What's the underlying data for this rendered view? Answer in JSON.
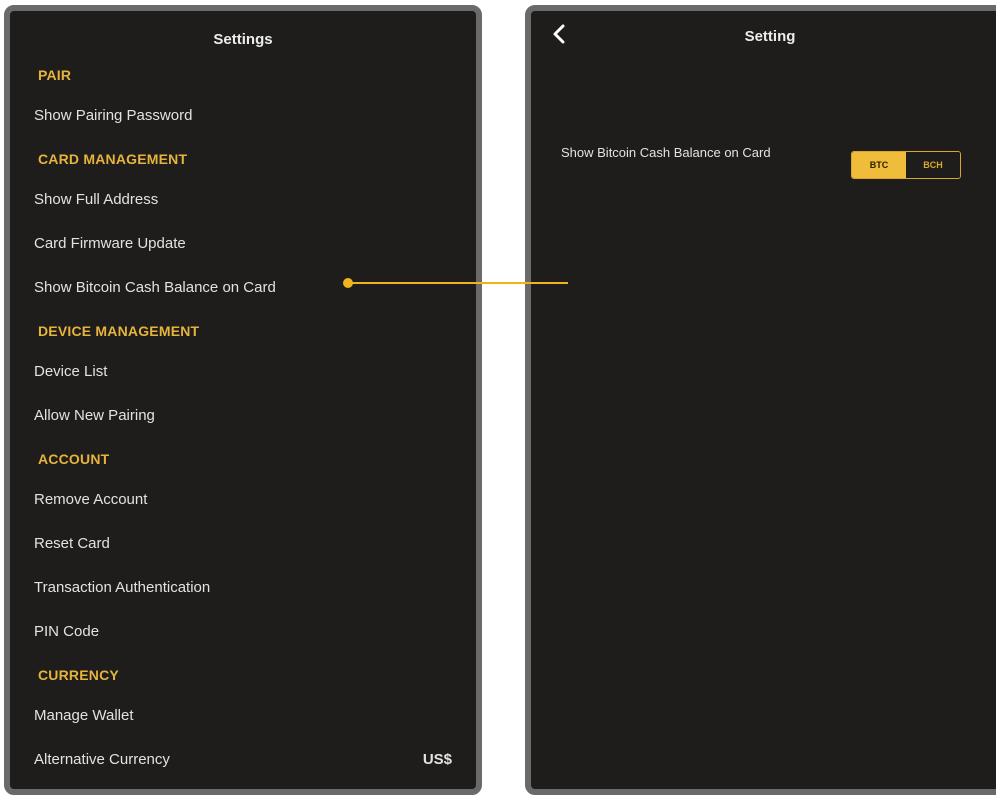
{
  "left_screen": {
    "title": "Settings",
    "sections": [
      {
        "label": "PAIR",
        "items": [
          {
            "label": "Show Pairing Password"
          }
        ]
      },
      {
        "label": "CARD MANAGEMENT",
        "items": [
          {
            "label": "Show Full Address"
          },
          {
            "label": "Card Firmware Update"
          },
          {
            "label": "Show Bitcoin Cash Balance on Card"
          }
        ]
      },
      {
        "label": "DEVICE MANAGEMENT",
        "items": [
          {
            "label": "Device List"
          },
          {
            "label": "Allow New Pairing"
          }
        ]
      },
      {
        "label": "ACCOUNT",
        "items": [
          {
            "label": "Remove Account"
          },
          {
            "label": "Reset Card"
          },
          {
            "label": "Transaction Authentication"
          },
          {
            "label": "PIN Code"
          }
        ]
      },
      {
        "label": "CURRENCY",
        "items": [
          {
            "label": "Manage Wallet"
          },
          {
            "label": "Alternative Currency",
            "value": "US$"
          }
        ]
      }
    ]
  },
  "right_screen": {
    "title": "Setting",
    "back_icon": "chevron-left-icon",
    "setting_label": "Show Bitcoin Cash Balance on Card",
    "toggle": {
      "options": [
        "BTC",
        "BCH"
      ],
      "selected": "BTC"
    }
  },
  "colors": {
    "background": "#1e1d1b",
    "accent": "#f0bd3a",
    "section_text": "#e6b33c",
    "text": "#e2e2e2",
    "frame": "#6a6a6a"
  }
}
